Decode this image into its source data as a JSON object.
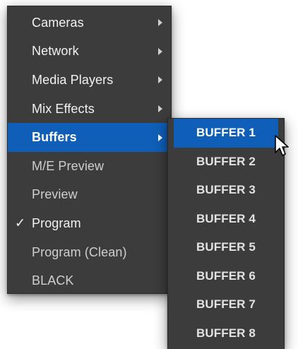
{
  "main_menu": {
    "items": [
      {
        "label": "Cameras",
        "has_submenu": true
      },
      {
        "label": "Network",
        "has_submenu": true
      },
      {
        "label": "Media Players",
        "has_submenu": true
      },
      {
        "label": "Mix Effects",
        "has_submenu": true
      },
      {
        "label": "Buffers",
        "has_submenu": true,
        "selected": true
      },
      {
        "label": "M/E Preview"
      },
      {
        "label": "Preview"
      },
      {
        "label": "Program",
        "checked": true,
        "check_mark": "✓"
      },
      {
        "label": "Program (Clean)"
      },
      {
        "label": "BLACK"
      }
    ]
  },
  "sub_menu": {
    "items": [
      {
        "label": "BUFFER 1",
        "selected": true
      },
      {
        "label": "BUFFER 2"
      },
      {
        "label": "BUFFER 3"
      },
      {
        "label": "BUFFER 4"
      },
      {
        "label": "BUFFER 5"
      },
      {
        "label": "BUFFER 6"
      },
      {
        "label": "BUFFER 7"
      },
      {
        "label": "BUFFER 8"
      }
    ]
  },
  "colors": {
    "menu_background": "#3c3c3c",
    "selection": "#0f5fb8",
    "text": "#cfcfcf"
  },
  "icons": {
    "submenu_arrow": "chevron-right-icon",
    "cursor": "mouse-pointer-icon"
  }
}
